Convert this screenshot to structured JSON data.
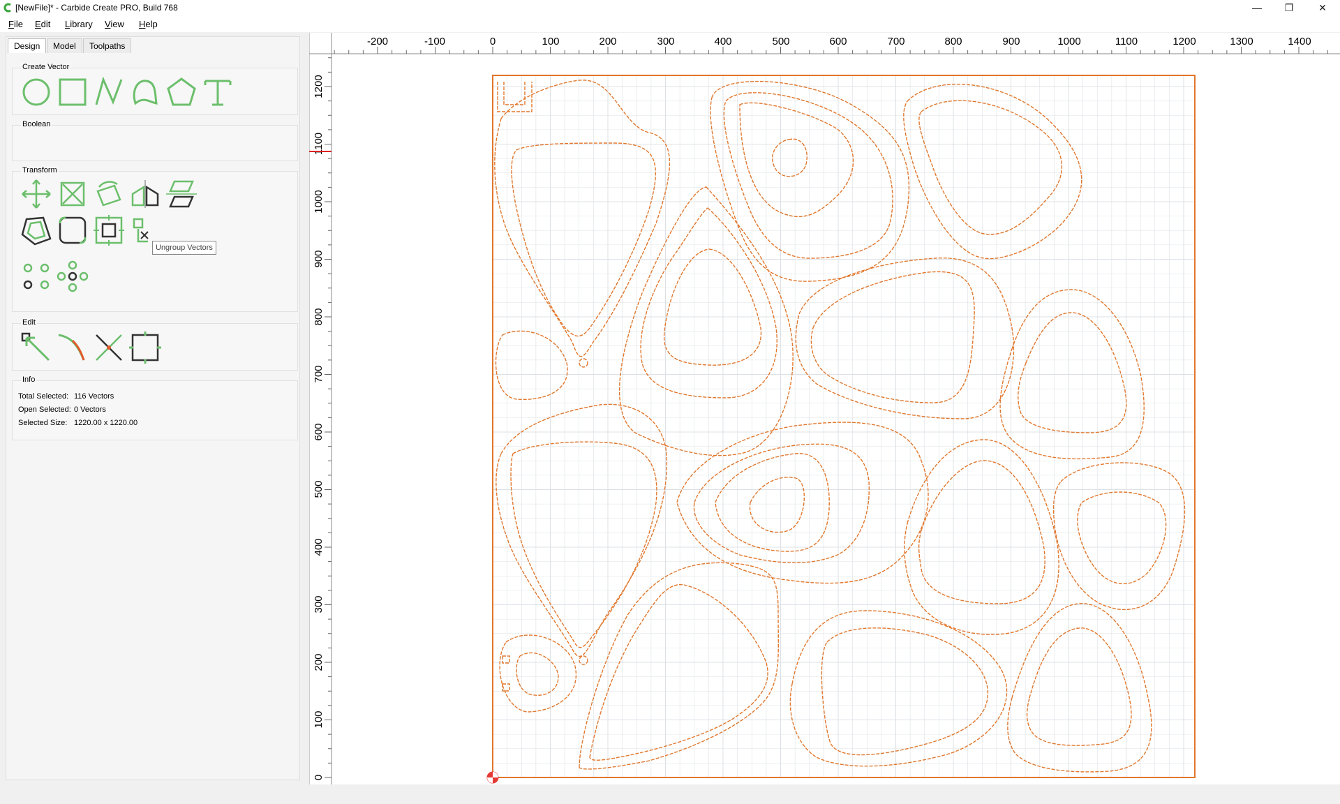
{
  "window": {
    "title": "[NewFile]* - Carbide Create PRO, Build 768",
    "minimize": "—",
    "restore": "❐",
    "close": "✕"
  },
  "menu": [
    {
      "label": "File"
    },
    {
      "label": "Edit"
    },
    {
      "label": "Library"
    },
    {
      "label": "View"
    },
    {
      "label": "Help"
    }
  ],
  "tabs": [
    "Design",
    "Model",
    "Toolpaths"
  ],
  "groups": {
    "create_vector": "Create Vector",
    "boolean": "Boolean",
    "transform": "Transform",
    "edit": "Edit",
    "info": "Info"
  },
  "tooltip": "Ungroup Vectors",
  "info": {
    "total_selected_label": "Total Selected:",
    "total_selected_value": "116 Vectors",
    "open_selected_label": "Open Selected:",
    "open_selected_value": "0 Vectors",
    "selected_size_label": "Selected Size:",
    "selected_size_value": "1220.00 x 1220.00"
  },
  "ruler": {
    "x_labels": [
      "-200",
      "-100",
      "0",
      "100",
      "200",
      "300",
      "400",
      "500",
      "600",
      "700",
      "800",
      "900",
      "1000",
      "1100",
      "1200",
      "1300",
      "1400"
    ],
    "y_labels": [
      "1200",
      "1100",
      "1000",
      "900",
      "800",
      "700",
      "600",
      "500",
      "400",
      "300",
      "200",
      "100",
      "0"
    ]
  },
  "workpiece": {
    "width": 1220,
    "height": 1220,
    "units": "mm"
  },
  "colors": {
    "accent": "#e2772c",
    "tool_green": "#6cbf6c",
    "tool_dark": "#333333",
    "grid": "#dde1e6"
  }
}
